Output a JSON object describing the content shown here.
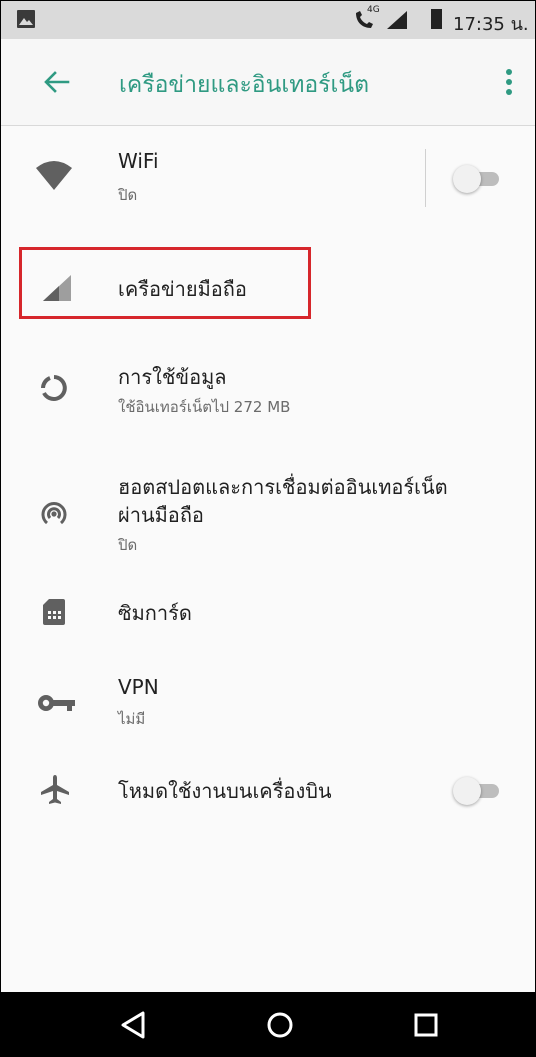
{
  "status_bar": {
    "network_type": "4G",
    "time": "17:35 น."
  },
  "app_bar": {
    "title": "เครือข่ายและอินเทอร์เน็ต",
    "accent_color": "#2f9a82"
  },
  "settings": {
    "wifi": {
      "title": "WiFi",
      "status": "ปิด",
      "toggle_on": false
    },
    "mobile_network": {
      "title": "เครือข่ายมือถือ"
    },
    "data_usage": {
      "title": "การใช้ข้อมูล",
      "status": "ใช้อินเทอร์เน็ตไป 272 MB"
    },
    "hotspot": {
      "title_line1": "ฮอตสปอตและการเชื่อมต่ออินเทอร์เน็ต",
      "title_line2": "ผ่านมือถือ",
      "status": "ปิด"
    },
    "sim_cards": {
      "title": "ซิมการ์ด"
    },
    "vpn": {
      "title": "VPN",
      "status": "ไม่มี"
    },
    "airplane_mode": {
      "title": "โหมดใช้งานบนเครื่องบิน",
      "toggle_on": false
    }
  },
  "highlight_color": "#d6262b",
  "icons": [
    "gallery-icon",
    "wifi-calling-icon",
    "signal-icon",
    "battery-icon",
    "back-arrow-icon",
    "more-vert-icon",
    "wifi-icon",
    "cellular-icon",
    "data-usage-icon",
    "hotspot-icon",
    "sim-card-icon",
    "vpn-key-icon",
    "airplane-icon",
    "nav-back-icon",
    "nav-home-icon",
    "nav-recents-icon"
  ]
}
